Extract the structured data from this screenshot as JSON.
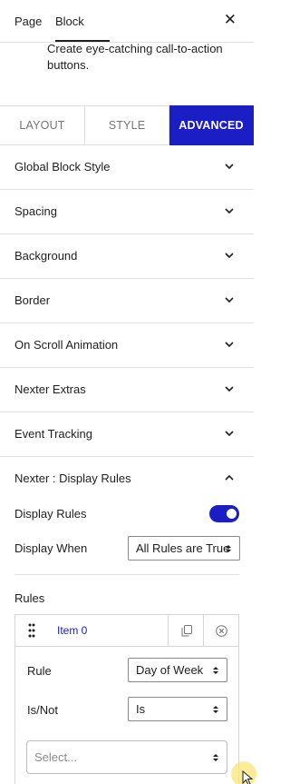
{
  "header": {
    "tabs": [
      "Page",
      "Block"
    ],
    "active_tab": "Block"
  },
  "block_description": "Create eye-catching call-to-action buttons.",
  "style_tabs": [
    "LAYOUT",
    "STYLE",
    "ADVANCED"
  ],
  "active_style_tab": "ADVANCED",
  "panels": [
    "Global Block Style",
    "Spacing",
    "Background",
    "Border",
    "On Scroll Animation",
    "Nexter Extras",
    "Event Tracking",
    "Nexter : Display Rules"
  ],
  "display_rules": {
    "toggle_label": "Display Rules",
    "toggle_on": true,
    "display_when_label": "Display When",
    "display_when_value": "All Rules are True",
    "rules_label": "Rules",
    "item": {
      "title": "Item 0",
      "rule_label": "Rule",
      "rule_value": "Day of Week",
      "isnot_label": "Is/Not",
      "isnot_value": "Is",
      "select_placeholder": "Select..."
    }
  },
  "colors": {
    "accent": "#1b1ec4",
    "text": "#1e1e1e",
    "border": "#e0e0e0"
  }
}
